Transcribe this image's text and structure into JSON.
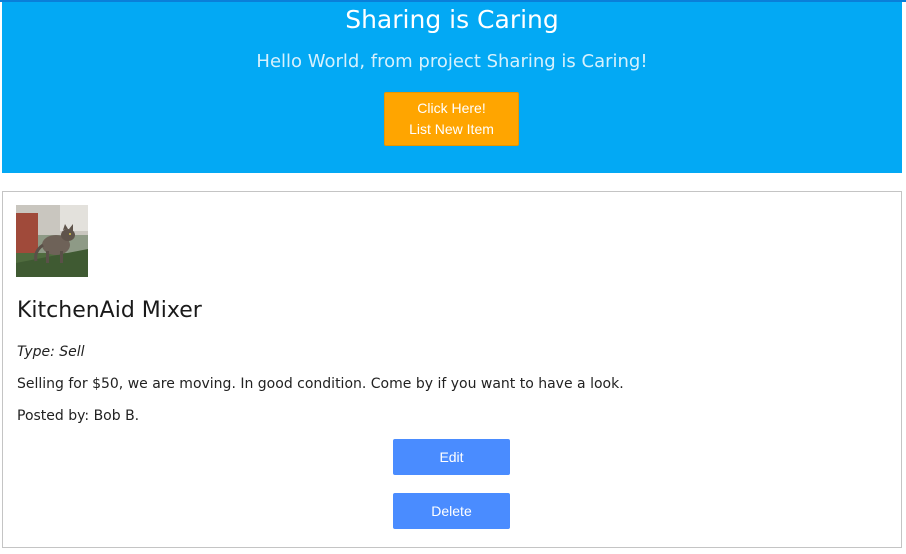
{
  "header": {
    "title": "Sharing is Caring",
    "subtitle": "Hello World, from project Sharing is Caring!",
    "list_button": {
      "line1": "Click Here!",
      "line2": "List New Item"
    }
  },
  "item": {
    "image_icon": "cat-photo",
    "title": "KitchenAid Mixer",
    "type": "Type: Sell",
    "description": "Selling for $50, we are moving. In good condition. Come by if you want to have a look.",
    "posted_by": "Posted by: Bob B.",
    "edit_label": "Edit",
    "delete_label": "Delete"
  },
  "colors": {
    "header_bg": "#03a9f4",
    "list_button_bg": "#ffa500",
    "action_button_bg": "#4a8cff"
  }
}
